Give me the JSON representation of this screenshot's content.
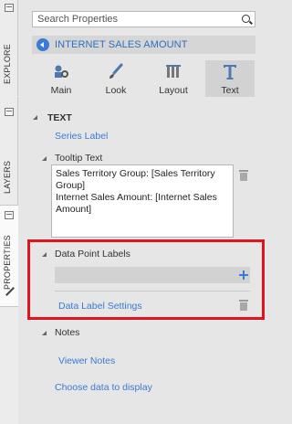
{
  "rail": {
    "tabs": [
      {
        "label": "EXPLORE",
        "icon": "panel-icon"
      },
      {
        "label": "LAYERS",
        "icon": "panel-icon"
      },
      {
        "label": "PROPERTIES",
        "icon": "panel-icon",
        "active": true
      }
    ]
  },
  "search": {
    "placeholder": "Search Properties"
  },
  "breadcrumb": {
    "text": "INTERNET SALES AMOUNT"
  },
  "tabs": [
    {
      "label": "Main",
      "icon": "main-icon"
    },
    {
      "label": "Look",
      "icon": "brush-icon"
    },
    {
      "label": "Layout",
      "icon": "layout-icon"
    },
    {
      "label": "Text",
      "icon": "text-t-icon",
      "active": true
    }
  ],
  "text_section": {
    "title": "TEXT",
    "series_label_link": "Series Label",
    "tooltip_title": "Tooltip Text",
    "tooltip_value": "Sales Territory Group: [Sales Territory Group]\nInternet Sales Amount: [Internet Sales Amount]"
  },
  "data_point_labels": {
    "title": "Data Point Labels",
    "settings_link": "Data Label Settings"
  },
  "notes": {
    "title": "Notes",
    "viewer_notes_link": "Viewer Notes",
    "choose_data_link": "Choose data to display"
  },
  "colors": {
    "accent": "#3a7bd5",
    "highlight": "#e0141e",
    "panel": "#e6e6e6"
  }
}
